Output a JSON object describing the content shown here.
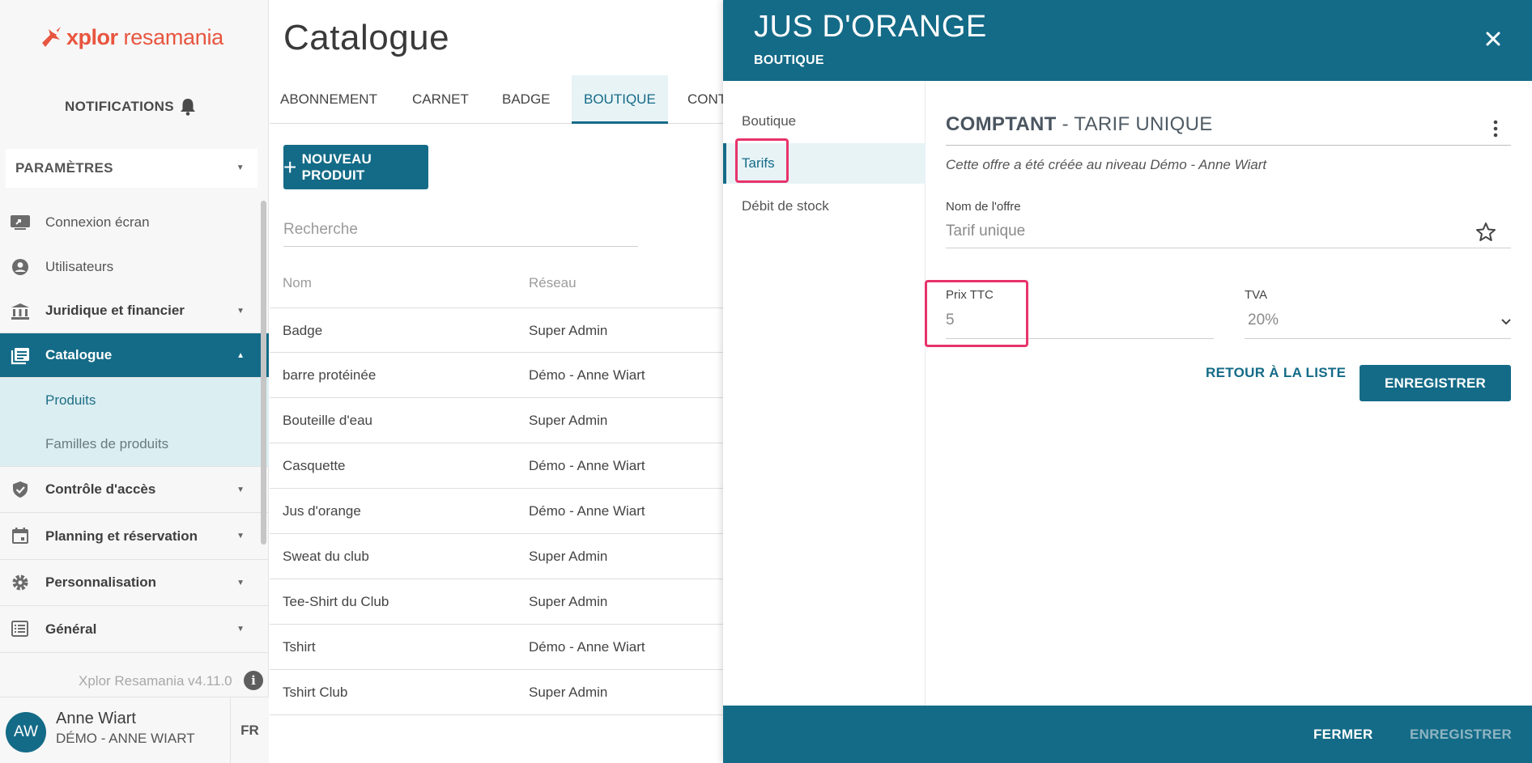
{
  "brand": {
    "name_bold": "xplor",
    "name_rest": "resamania",
    "color": "#e8553f"
  },
  "sidebar": {
    "notifications": "NOTIFICATIONS",
    "parameters": "PARAMÈTRES",
    "items": [
      {
        "label": "Connexion écran",
        "icon": "screen-share-icon"
      },
      {
        "label": "Utilisateurs",
        "icon": "user-circle-icon"
      },
      {
        "label": "Juridique et financier",
        "icon": "bank-icon"
      },
      {
        "label": "Catalogue",
        "icon": "catalog-icon"
      },
      {
        "label": "Contrôle d'accès",
        "icon": "shield-check-icon"
      },
      {
        "label": "Planning et réservation",
        "icon": "calendar-icon"
      },
      {
        "label": "Personnalisation",
        "icon": "gear-icon"
      },
      {
        "label": "Général",
        "icon": "list-icon"
      }
    ],
    "sub_items": [
      "Produits",
      "Familles de produits"
    ],
    "version": "Xplor Resamania v4.11.0",
    "user": {
      "initials": "AW",
      "name": "Anne Wiart",
      "org": "DÉMO - ANNE WIART",
      "lang": "FR"
    }
  },
  "main": {
    "title": "Catalogue",
    "tabs": [
      "ABONNEMENT",
      "CARNET",
      "BADGE",
      "BOUTIQUE",
      "CONT"
    ],
    "new_product": "NOUVEAU PRODUIT",
    "search_placeholder": "Recherche",
    "columns": [
      "Nom",
      "Réseau"
    ],
    "rows": [
      [
        "Badge",
        "Super Admin"
      ],
      [
        "barre protéinée",
        "Démo - Anne Wiart"
      ],
      [
        "Bouteille d'eau",
        "Super Admin"
      ],
      [
        "Casquette",
        "Démo - Anne Wiart"
      ],
      [
        "Jus d'orange",
        "Démo - Anne Wiart"
      ],
      [
        "Sweat du club",
        "Super Admin"
      ],
      [
        "Tee-Shirt du Club",
        "Super Admin"
      ],
      [
        "Tshirt",
        "Démo - Anne Wiart"
      ],
      [
        "Tshirt Club",
        "Super Admin"
      ]
    ]
  },
  "drawer": {
    "title": "JUS D'ORANGE",
    "subtitle": "BOUTIQUE",
    "menu": [
      "Boutique",
      "Tarifs",
      "Débit de stock"
    ],
    "offer_bold": "COMPTANT",
    "offer_rest": " - TARIF UNIQUE",
    "note": "Cette offre a été créée au niveau Démo - Anne Wiart",
    "offer_name_label": "Nom de l'offre",
    "offer_name_value": "Tarif unique",
    "price_label": "Prix TTC",
    "price_value": "5",
    "vat_label": "TVA",
    "vat_value": "20%",
    "back_to_list": "RETOUR À LA LISTE",
    "save": "ENREGISTRER",
    "footer_close": "FERMER",
    "footer_save": "ENREGISTRER"
  },
  "colors": {
    "primary": "#146b87",
    "highlight": "#e8336a",
    "accent_light": "#e8f3f6"
  }
}
